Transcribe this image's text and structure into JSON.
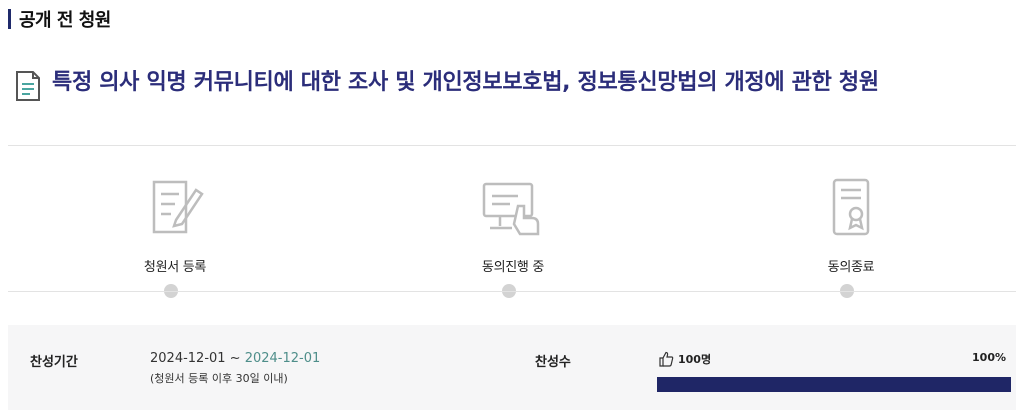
{
  "section": {
    "label": "공개 전 청원"
  },
  "petition": {
    "title": "특정 의사 익명 커뮤니티에 대한 조사 및 개인정보보호법, 정보통신망법의 개정에 관한 청원",
    "icon": "document-icon"
  },
  "steps": [
    {
      "label": "청원서 등록",
      "icon": "document-pen-icon",
      "active": false
    },
    {
      "label": "동의진행 중",
      "icon": "monitor-hand-icon",
      "active": false
    },
    {
      "label": "동의종료",
      "icon": "certificate-icon",
      "active": false
    }
  ],
  "info": {
    "period_label": "찬성기간",
    "period_start": "2024-12-01 ~ ",
    "period_end": "2024-12-01",
    "period_note": "(청원서 등록 이후 30일 이내)",
    "count_label": "찬성수",
    "count_value": "100명",
    "count_icon": "thumbs-up-icon",
    "percent_label": "100%",
    "progress": 1.0
  },
  "colors": {
    "accent": "#2b2d7a",
    "progress_fill": "#1f2666",
    "date_end": "#4e8e8a",
    "dot": "#d3d3d3"
  }
}
